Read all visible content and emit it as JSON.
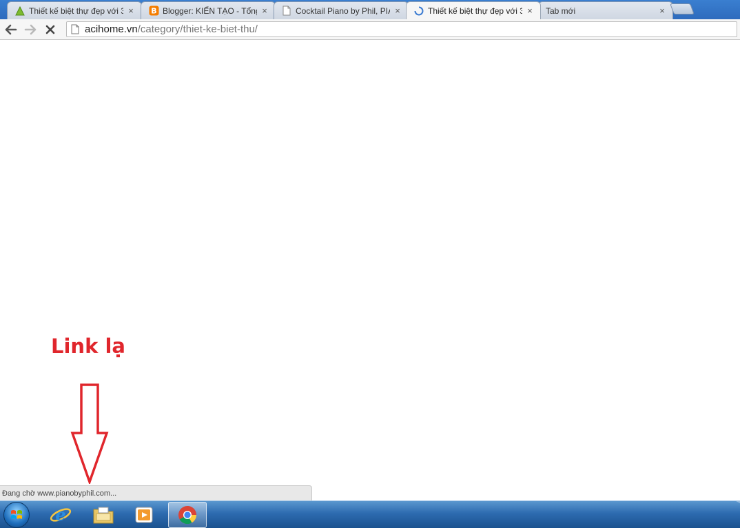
{
  "tabs": [
    {
      "title": "Thiết kế biệt thự đẹp với 3",
      "icon": "green-triangle-favicon",
      "close": "×"
    },
    {
      "title": "Blogger: KIẾN TẠO - Tổng",
      "icon": "blogger-favicon",
      "close": "×"
    },
    {
      "title": "Cocktail Piano by Phil, PIA",
      "icon": "page-favicon",
      "close": "×"
    },
    {
      "title": "Thiết kế biệt thự đẹp với 3",
      "icon": "loading-spinner-icon",
      "close": "×",
      "active": true
    },
    {
      "title": "Tab mới",
      "icon": "",
      "close": "×"
    }
  ],
  "address_bar": {
    "host": "acihome.vn",
    "path": "/category/thiet-ke-biet-thu/"
  },
  "annotation": {
    "text": "Link lạ",
    "color": "#e0262c"
  },
  "status_bubble": {
    "text": "Đang chờ www.pianobyphil.com..."
  },
  "taskbar": {
    "items": [
      "start-orb",
      "internet-explorer-icon",
      "file-explorer-icon",
      "media-player-icon",
      "chrome-icon"
    ],
    "active_item": "chrome-icon"
  }
}
